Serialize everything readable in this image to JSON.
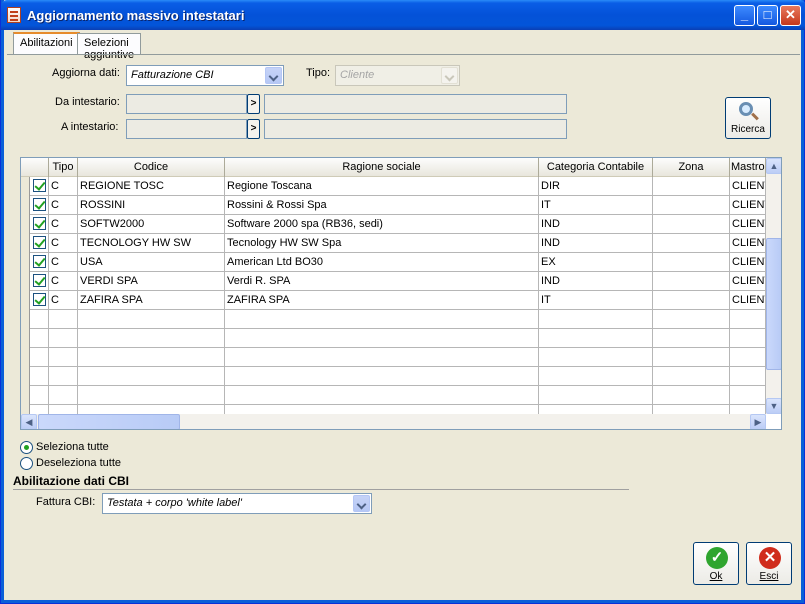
{
  "window": {
    "title": "Aggiornamento massivo intestatari",
    "controls": {
      "minimize": "_",
      "maximize": "□",
      "close": "✕"
    }
  },
  "tabs": [
    {
      "label": "Abilitazioni",
      "active": true
    },
    {
      "label": "Selezioni aggiuntive",
      "active": false
    }
  ],
  "filters": {
    "aggiorna_dati_label": "Aggiorna dati:",
    "aggiorna_dati_value": "Fatturazione CBI",
    "tipo_label": "Tipo:",
    "tipo_value": "Cliente",
    "da_intestario_label": "Da intestario:",
    "a_intestario_label": "A intestario:",
    "zoom_glyph": ">",
    "search_button": "Ricerca"
  },
  "grid": {
    "columns": [
      "Tipo",
      "Codice",
      "Ragione sociale",
      "Categoria Contabile",
      "Zona",
      "Mastro"
    ],
    "rows": [
      {
        "checked": true,
        "tipo": "C",
        "codice": "REGIONE TOSC",
        "ragione": "Regione Toscana",
        "categoria": "DIR",
        "zona": "",
        "mastro": "CLIENT"
      },
      {
        "checked": true,
        "tipo": "C",
        "codice": "ROSSINI",
        "ragione": "Rossini & Rossi Spa",
        "categoria": "IT",
        "zona": "",
        "mastro": "CLIENT"
      },
      {
        "checked": true,
        "tipo": "C",
        "codice": "SOFTW2000",
        "ragione": "Software 2000 spa (RB36, sedi)",
        "categoria": "IND",
        "zona": "",
        "mastro": "CLIENT"
      },
      {
        "checked": true,
        "tipo": "C",
        "codice": "TECNOLOGY HW SW",
        "ragione": "Tecnology HW  SW Spa",
        "categoria": "IND",
        "zona": "",
        "mastro": "CLIENT"
      },
      {
        "checked": true,
        "tipo": "C",
        "codice": "USA",
        "ragione": "American Ltd BO30",
        "categoria": "EX",
        "zona": "",
        "mastro": "CLIENT"
      },
      {
        "checked": true,
        "tipo": "C",
        "codice": "VERDI SPA",
        "ragione": "Verdi R. SPA",
        "categoria": "IND",
        "zona": "",
        "mastro": "CLIENT"
      },
      {
        "checked": true,
        "tipo": "C",
        "codice": "ZAFIRA SPA",
        "ragione": "ZAFIRA SPA",
        "categoria": "IT",
        "zona": "",
        "mastro": "CLIENT"
      }
    ],
    "empty_rows": 6
  },
  "selection": {
    "select_all": "Seleziona tutte",
    "deselect_all": "Deseleziona tutte",
    "selected": "select_all"
  },
  "cbi": {
    "section_title": "Abilitazione dati CBI",
    "fattura_label": "Fattura CBI:",
    "fattura_value": "Testata + corpo 'white label'"
  },
  "actions": {
    "ok": "Ok",
    "esci": "Esci"
  },
  "colors": {
    "title_bar": "#0452d8",
    "face": "#ece9d8",
    "ok": "#2fa52f",
    "esci": "#d02c1c"
  }
}
